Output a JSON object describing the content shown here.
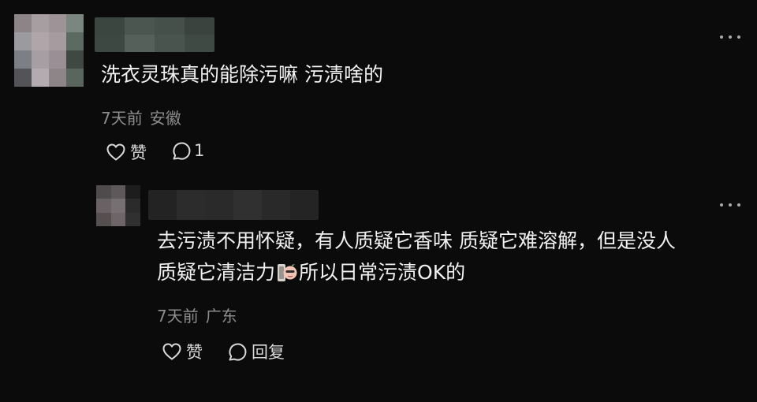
{
  "comment": {
    "text": "洗衣灵珠真的能除污嘛 污渍啥的",
    "time": "7天前",
    "location": "安徽",
    "like_label": "赞",
    "reply_count": "1",
    "icons": [
      "heart-icon",
      "comment-bubble-icon",
      "more-dots-icon"
    ]
  },
  "reply": {
    "text_line1": "去污渍不用怀疑，有人质疑它香味 质疑它难溶解，但是没人",
    "text_line2_before": "质疑它清洁力",
    "text_line2_after": "所以日常污渍OK的",
    "sticker": "thumbs-up-sticker-icon",
    "time": "7天前",
    "location": "广东",
    "like_label": "赞",
    "reply_label": "回复",
    "icons": [
      "heart-icon",
      "comment-bubble-icon",
      "more-dots-icon"
    ]
  },
  "colors": {
    "background": "#0b0b0b",
    "text": "#f1f1f1",
    "meta": "#8e8e8e"
  }
}
